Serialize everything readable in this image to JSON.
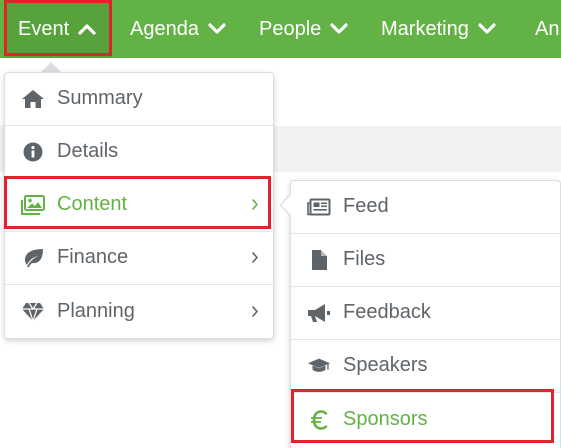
{
  "nav": {
    "items": [
      {
        "label": "Event",
        "icon": "chevron-up-icon"
      },
      {
        "label": "Agenda",
        "icon": "chevron-down-icon"
      },
      {
        "label": "People",
        "icon": "chevron-down-icon"
      },
      {
        "label": "Marketing",
        "icon": "chevron-down-icon"
      },
      {
        "label": "An"
      }
    ]
  },
  "event_menu": {
    "items": [
      {
        "label": "Summary",
        "icon": "home-icon"
      },
      {
        "label": "Details",
        "icon": "info-icon"
      },
      {
        "label": "Content",
        "icon": "images-icon",
        "has_submenu": true,
        "active": true
      },
      {
        "label": "Finance",
        "icon": "leaf-icon",
        "has_submenu": true
      },
      {
        "label": "Planning",
        "icon": "diamond-icon",
        "has_submenu": true
      }
    ]
  },
  "content_submenu": {
    "items": [
      {
        "label": "Feed",
        "icon": "newspaper-icon"
      },
      {
        "label": "Files",
        "icon": "file-icon"
      },
      {
        "label": "Feedback",
        "icon": "megaphone-icon"
      },
      {
        "label": "Speakers",
        "icon": "graduation-cap-icon"
      },
      {
        "label": "Sponsors",
        "icon": "euro-icon",
        "active": true
      }
    ]
  },
  "colors": {
    "nav_green": "#63b245",
    "active_green": "#63b245",
    "highlight_red": "#e0242b",
    "menu_text": "#5f6469"
  }
}
